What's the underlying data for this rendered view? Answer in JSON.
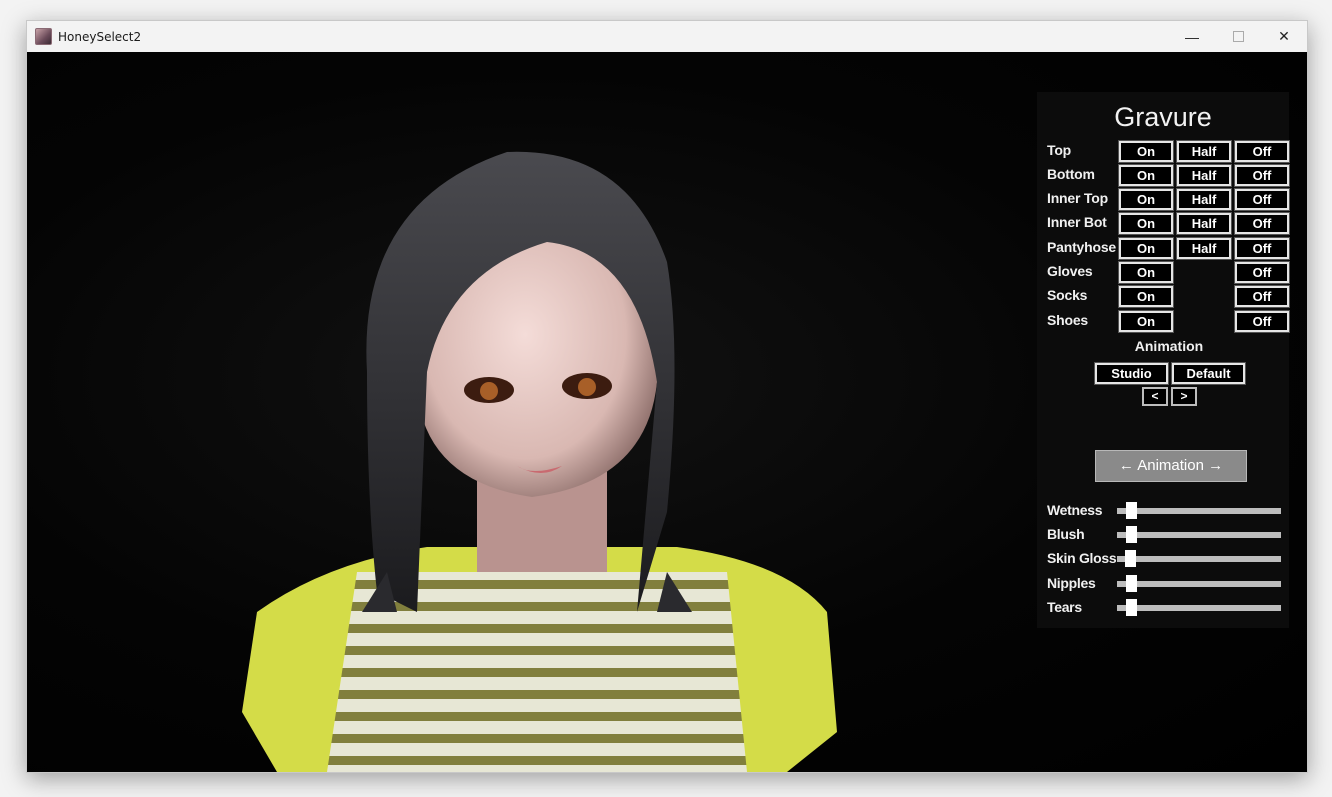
{
  "window": {
    "title": "HoneySelect2"
  },
  "panel": {
    "title": "Gravure",
    "rows": [
      {
        "label": "Top",
        "on": "On",
        "half": "Half",
        "off": "Off"
      },
      {
        "label": "Bottom",
        "on": "On",
        "half": "Half",
        "off": "Off"
      },
      {
        "label": "Inner Top",
        "on": "On",
        "half": "Half",
        "off": "Off"
      },
      {
        "label": "Inner Bot",
        "on": "On",
        "half": "Half",
        "off": "Off"
      },
      {
        "label": "Pantyhose",
        "on": "On",
        "half": "Half",
        "off": "Off"
      },
      {
        "label": "Gloves",
        "on": "On",
        "off": "Off"
      },
      {
        "label": "Socks",
        "on": "On",
        "off": "Off"
      },
      {
        "label": "Shoes",
        "on": "On",
        "off": "Off"
      }
    ],
    "animation_label": "Animation",
    "studio_label": "Studio",
    "default_label": "Default",
    "prev_label": "<",
    "next_label": ">",
    "animation_button": "← Animation →",
    "sliders": [
      {
        "label": "Wetness",
        "value": 0.06
      },
      {
        "label": "Blush",
        "value": 0.06
      },
      {
        "label": "Skin Gloss",
        "value": 0.05
      },
      {
        "label": "Nipples",
        "value": 0.06
      },
      {
        "label": "Tears",
        "value": 0.06
      }
    ]
  },
  "colors": {
    "panel_bg": "#0c0c0c",
    "button_border": "#e6e6e6",
    "big_button_bg": "#8a8a8a",
    "slider_track": "#bdbdbd"
  },
  "icons": {
    "app": "honeyselect-app-icon",
    "minimize": "minimize-icon",
    "maximize": "maximize-icon",
    "close": "close-icon"
  }
}
